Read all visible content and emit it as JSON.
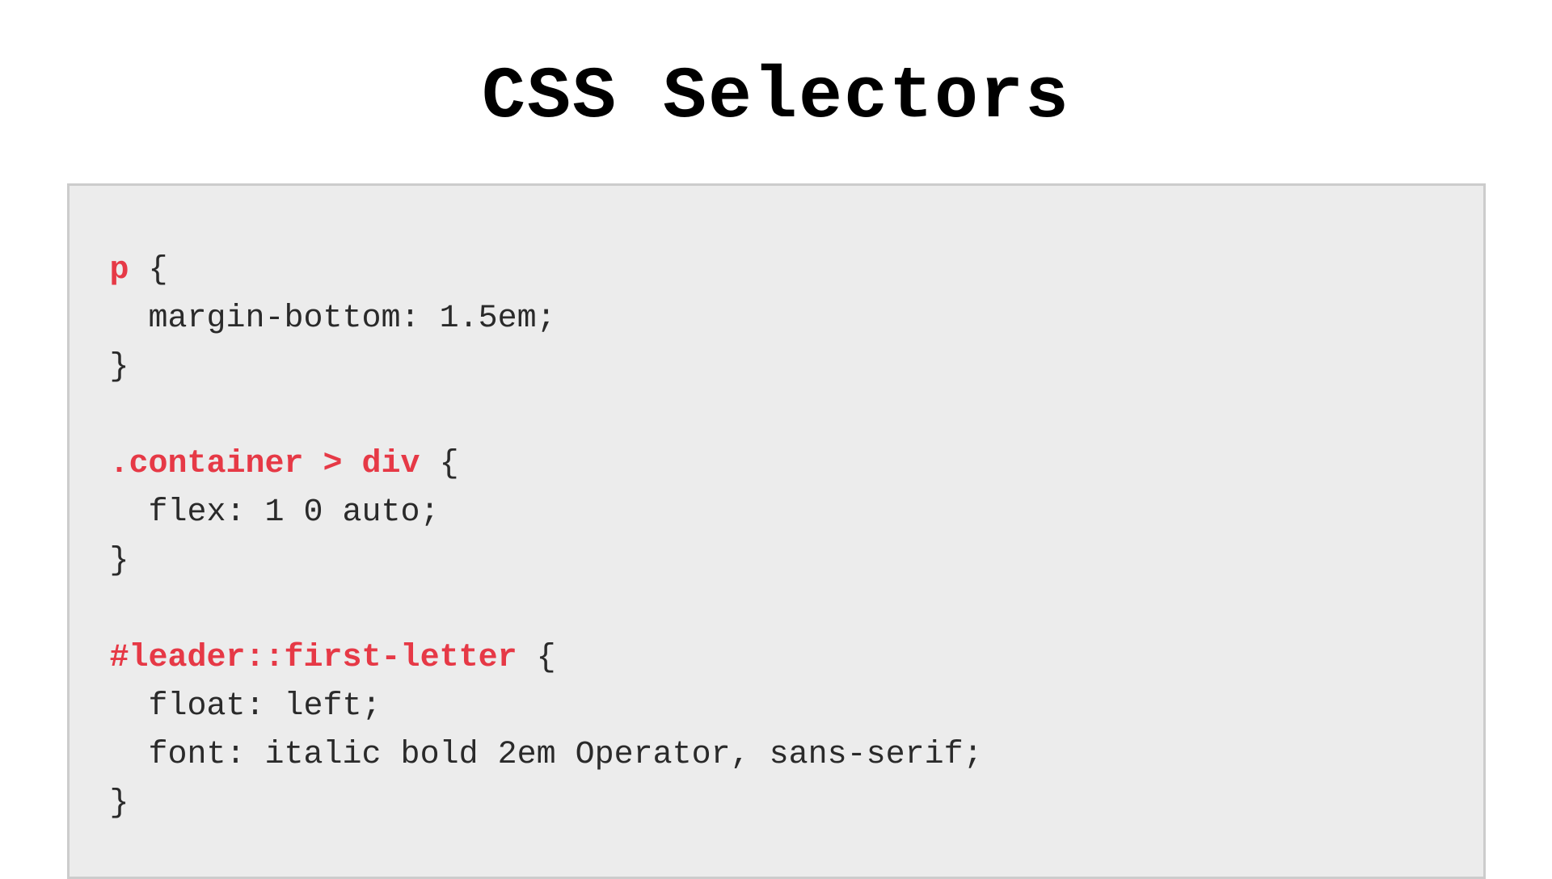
{
  "title": "CSS Selectors",
  "code": {
    "rule1": {
      "selector": "p",
      "brace_open": " {",
      "declaration1": "  margin-bottom: 1.5em;",
      "brace_close": "}"
    },
    "rule2": {
      "selector": ".container > div",
      "brace_open": " {",
      "declaration1": "  flex: 1 0 auto;",
      "brace_close": "}"
    },
    "rule3": {
      "selector": "#leader::first-letter",
      "brace_open": " {",
      "declaration1": "  float: left;",
      "declaration2": "  font: italic bold 2em Operator, sans-serif;",
      "brace_close": "}"
    }
  },
  "colors": {
    "selector": "#e63946",
    "text": "#2a2a2a",
    "box_bg": "#ececec",
    "box_border": "#cccccc"
  }
}
